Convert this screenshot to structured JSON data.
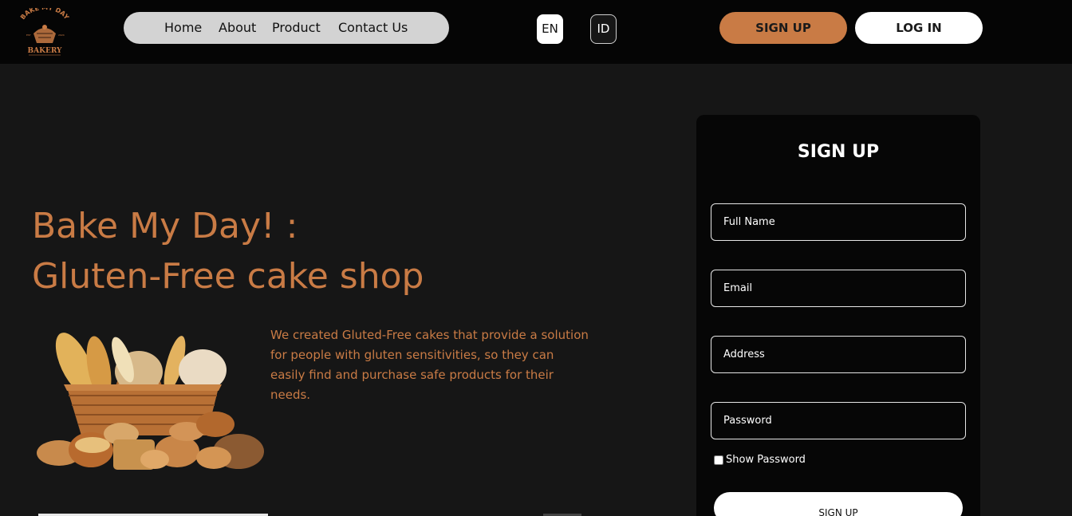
{
  "brand": {
    "logo_line1": "BAKE MY DAY",
    "logo_line2": "BAKERY"
  },
  "nav": {
    "items": [
      {
        "label": "Home"
      },
      {
        "label": "About"
      },
      {
        "label": "Product"
      },
      {
        "label": "Contact Us"
      }
    ]
  },
  "lang": {
    "en": "EN",
    "id": "ID"
  },
  "header_buttons": {
    "signup": "SIGN UP",
    "login": "LOG IN"
  },
  "hero": {
    "title_line1": "Bake My Day! :",
    "title_line2": "Gluten-Free cake shop",
    "description": "We created Gluted-Free cakes that provide a solution for people with gluten sensitivities, so they can easily find and purchase safe products for their needs."
  },
  "form": {
    "title": "SIGN UP",
    "full_name_placeholder": "Full Name",
    "email_placeholder": "Email",
    "address_placeholder": "Address",
    "password_placeholder": "Password",
    "show_password_label": "Show Password",
    "submit_label": "SIGN UP"
  },
  "colors": {
    "accent": "#c97b45",
    "header_bg": "#050505",
    "page_bg": "#161616",
    "nav_pill": "#d3d3d3"
  }
}
